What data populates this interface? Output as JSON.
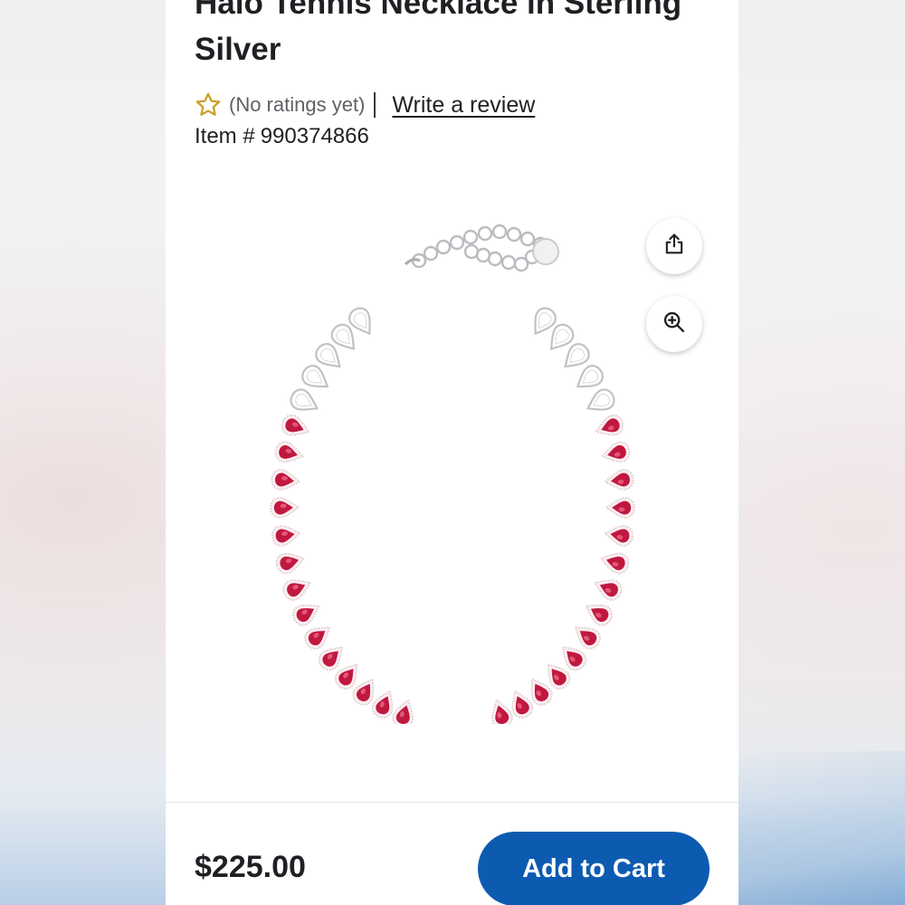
{
  "product": {
    "title": "Halo Tennis Necklace in Sterling Silver",
    "rating_text": "(No ratings yet)",
    "review_link": "Write a review",
    "item_label": "Item #",
    "item_number": "990374866"
  },
  "icons": {
    "rating": "star-outline-icon",
    "share": "share-icon",
    "zoom": "zoom-in-icon"
  },
  "footer": {
    "price": "$225.00",
    "cart_label": "Add to Cart"
  },
  "colors": {
    "accent": "#0d5bb1",
    "star": "#c9a227",
    "stone": "#c0183f",
    "text": "#1f2024"
  }
}
